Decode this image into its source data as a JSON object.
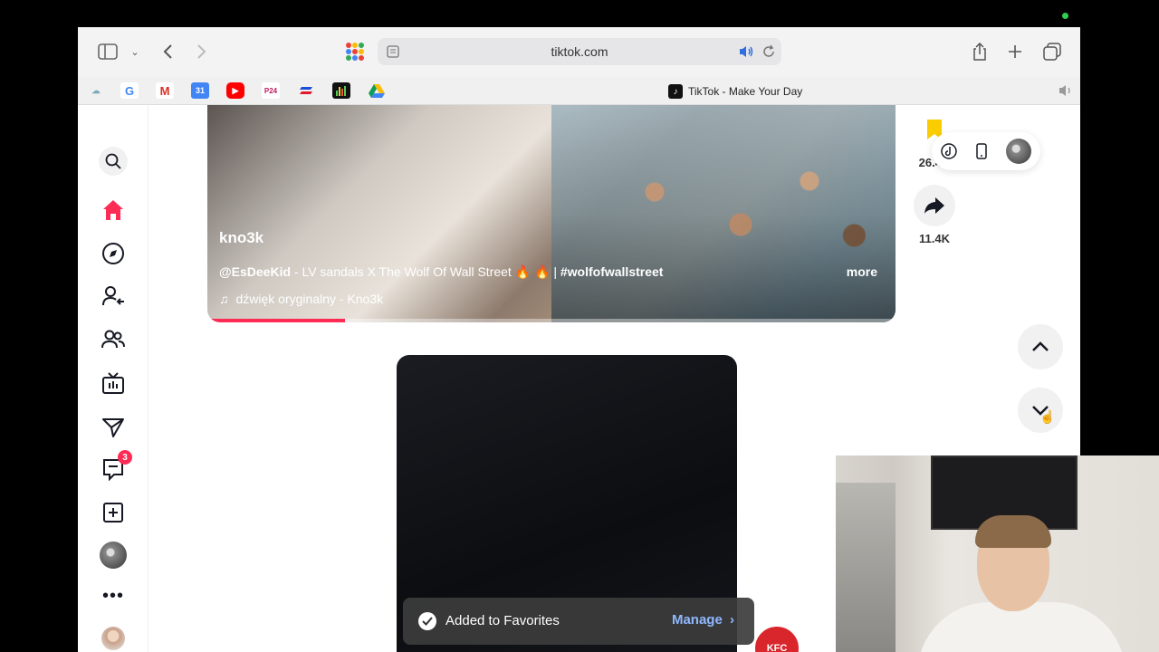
{
  "browser": {
    "url": "tiktok.com",
    "tab_title": "TikTok - Make Your Day",
    "bookmarks": [
      {
        "name": "google",
        "label": "G",
        "color": "#ffffff"
      },
      {
        "name": "gmail",
        "label": "M",
        "color": "#ffffff"
      },
      {
        "name": "calendar",
        "label": "31",
        "color": "#4285f4"
      },
      {
        "name": "youtube",
        "label": "▶",
        "color": "#ff0000"
      },
      {
        "name": "p24",
        "label": "P24",
        "color": "#ffffff"
      },
      {
        "name": "bookmark-stripes",
        "label": "",
        "color": "#e0192d"
      },
      {
        "name": "bookmark-chart",
        "label": "",
        "color": "#111111"
      },
      {
        "name": "drive",
        "label": "",
        "color": "#0f9d58"
      }
    ]
  },
  "sidebar": {
    "messages_badge": "3",
    "items": [
      "search-icon",
      "home-icon",
      "explore-icon",
      "following-icon",
      "friends-icon",
      "live-icon",
      "inbox-icon",
      "messages-icon",
      "upload-icon",
      "profile-avatar",
      "more-icon"
    ]
  },
  "video1": {
    "username": "kno3k",
    "caption_mention": "@EsDeeKid",
    "caption_text": " - LV sandals X The Wolf Of Wall Street 🔥 🔥 | ",
    "caption_hashtag": "#wolfofwallstreet",
    "more_label": "more",
    "sound": "dźwięk oryginalny - Kno3k",
    "progress": 0.2
  },
  "actions": {
    "favorites_count": "26.4K",
    "share_count": "11.4K"
  },
  "toast": {
    "message": "Added to Favorites",
    "manage_label": "Manage"
  },
  "colors": {
    "accent": "#fe2c55",
    "toast_link": "#8fb8ff",
    "kfc": "#d9262c"
  }
}
